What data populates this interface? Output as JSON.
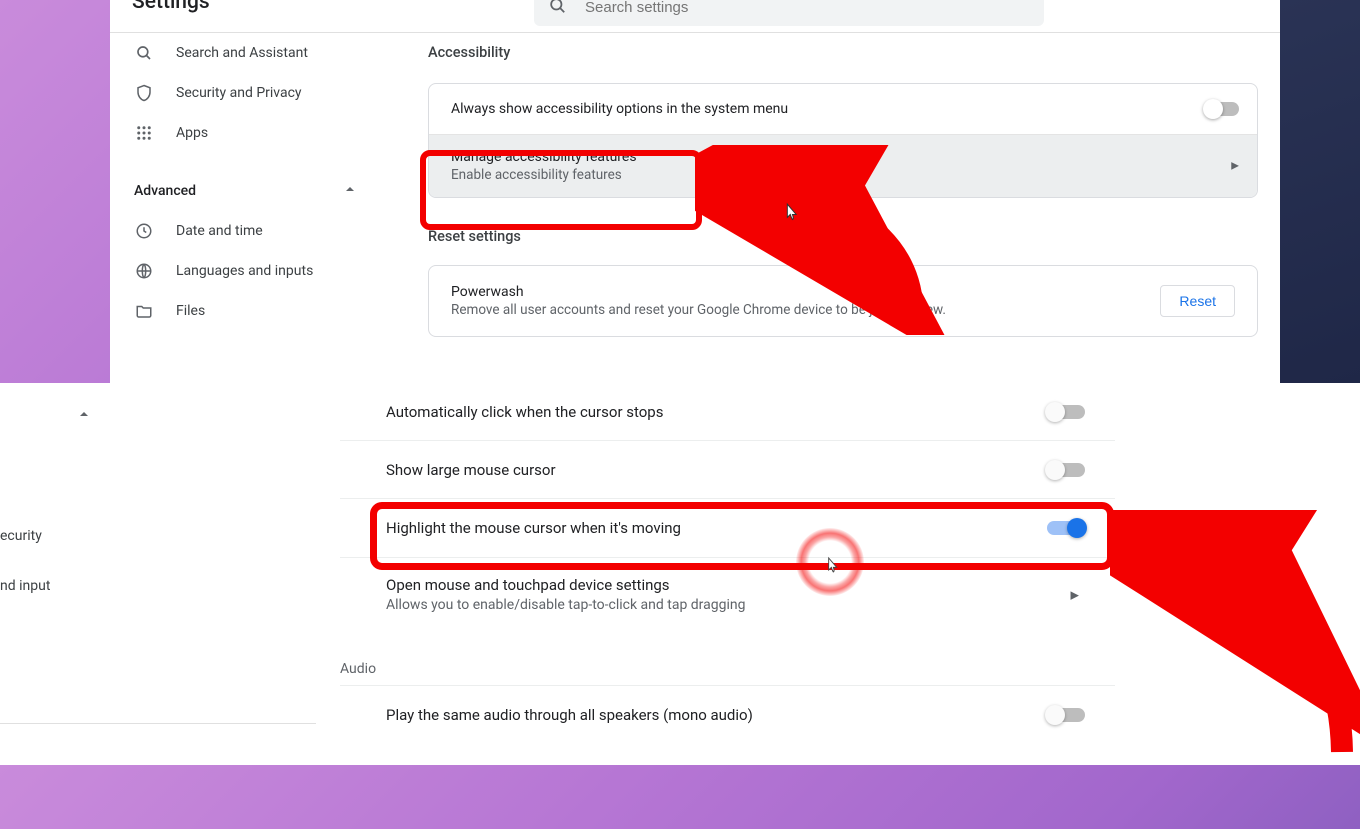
{
  "header": {
    "title": "Settings",
    "search_placeholder": "Search settings"
  },
  "sidebar": {
    "items": [
      {
        "label": "Search and Assistant"
      },
      {
        "label": "Security and Privacy"
      },
      {
        "label": "Apps"
      }
    ],
    "advanced_label": "Advanced",
    "adv_items": [
      {
        "label": "Date and time"
      },
      {
        "label": "Languages and inputs"
      },
      {
        "label": "Files"
      }
    ]
  },
  "accessibility": {
    "title": "Accessibility",
    "row1": "Always show accessibility options in the system menu",
    "row2_primary": "Manage accessibility features",
    "row2_secondary": "Enable accessibility features"
  },
  "reset": {
    "title": "Reset settings",
    "primary": "Powerwash",
    "secondary": "Remove all user accounts and reset your Google Chrome device to be just like new.",
    "button": "Reset"
  },
  "partial_sidebar": {
    "item1": "ecurity",
    "item2": "nd input"
  },
  "mouse": {
    "auto_click": "Automatically click when the cursor stops",
    "large_cursor": "Show large mouse cursor",
    "highlight": "Highlight the mouse cursor when it's moving",
    "open_primary": "Open mouse and touchpad device settings",
    "open_secondary": "Allows you to enable/disable tap-to-click and tap dragging"
  },
  "audio": {
    "title": "Audio",
    "mono": "Play the same audio through all speakers (mono audio)"
  }
}
